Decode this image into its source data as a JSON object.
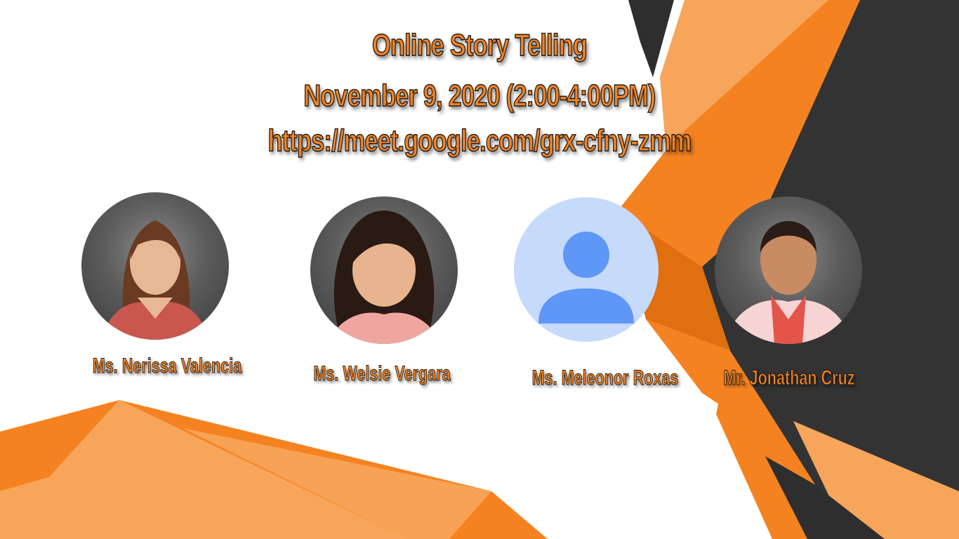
{
  "event": {
    "title": "Online Story Telling",
    "date_time": "November 9, 2020 (2:00-4:00PM)",
    "link": "https://meet.google.com/grx-cfny-zmm"
  },
  "speakers": [
    {
      "name": "Ms. Nerissa Valencia",
      "avatar": "photo"
    },
    {
      "name": "Ms. Welsie Vergara",
      "avatar": "photo"
    },
    {
      "name": "Ms. Meleonor Roxas",
      "avatar": "default-person-icon"
    },
    {
      "name": "Mr. Jonathan Cruz",
      "avatar": "photo"
    }
  ],
  "colors": {
    "accent_orange": "#f58220",
    "light_orange": "#f7a55a",
    "dark_gray": "#333333",
    "default_avatar_bg": "#c6dafc",
    "default_avatar_fg": "#5e97f6"
  }
}
